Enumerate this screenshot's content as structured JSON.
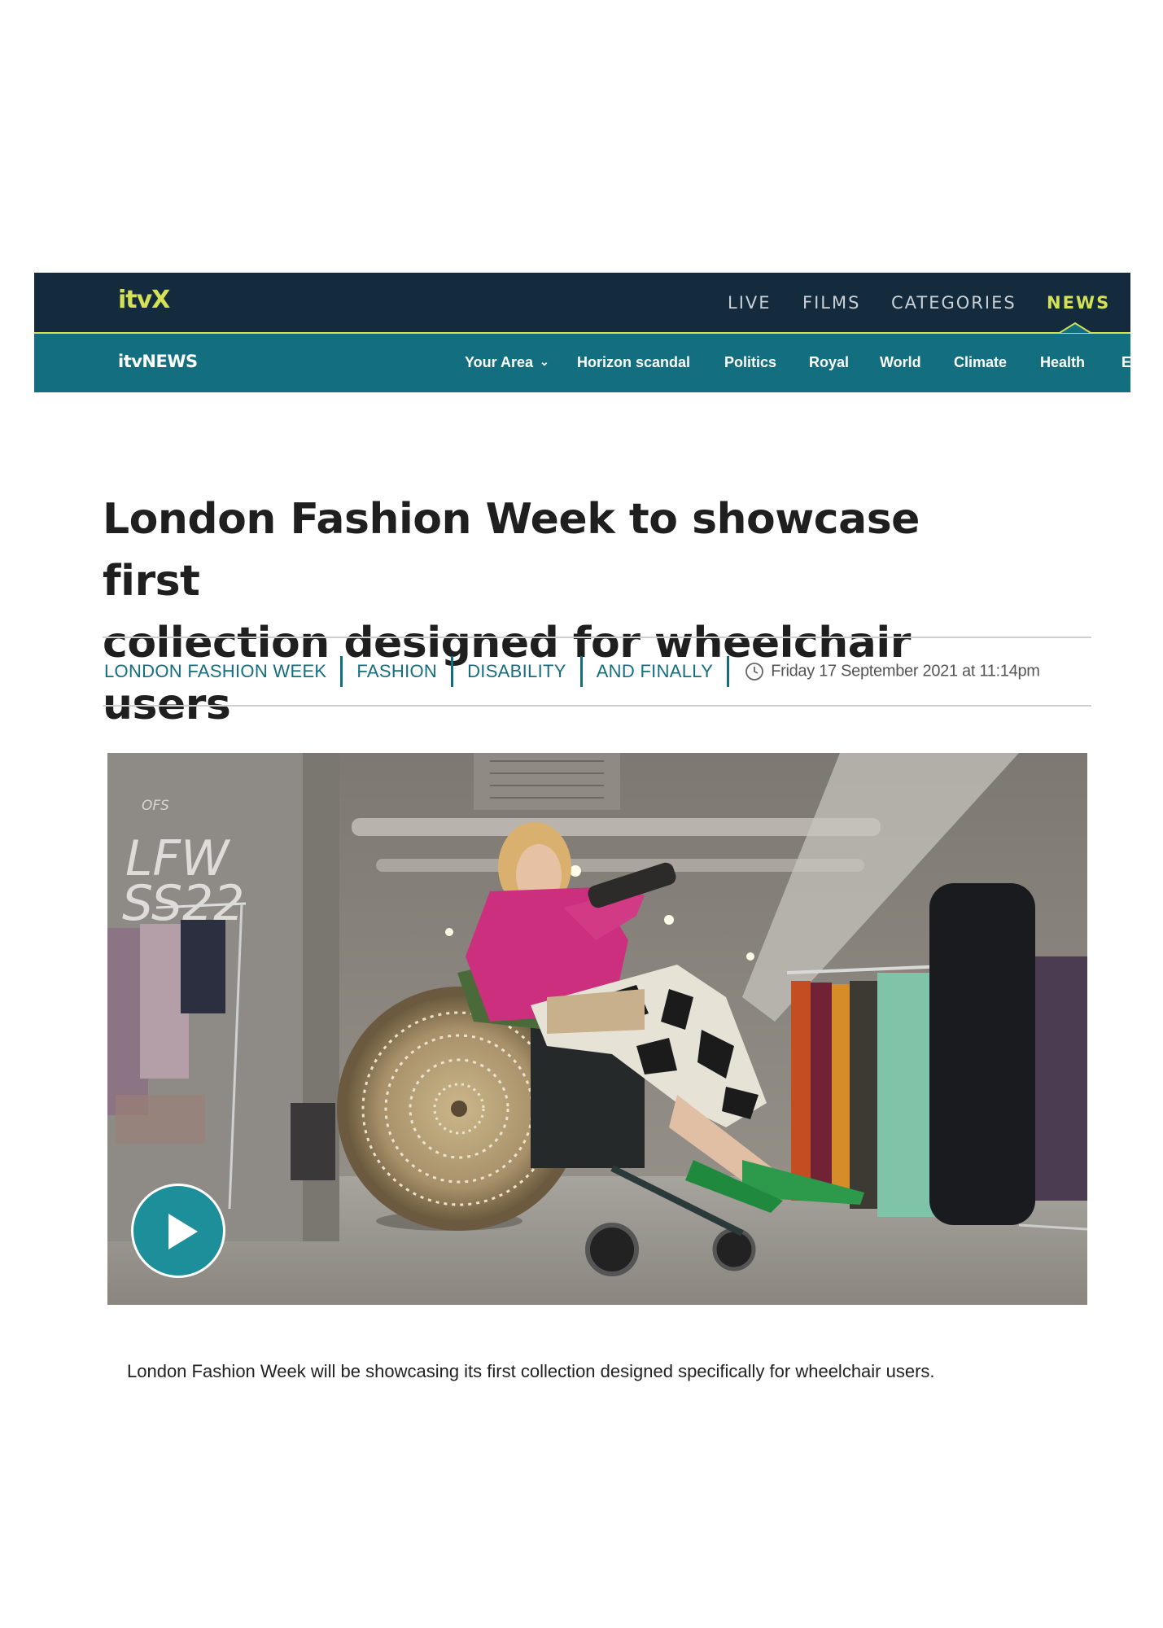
{
  "top_nav": {
    "logo": "itvX",
    "links": [
      "LIVE",
      "FILMS",
      "CATEGORIES",
      "NEWS"
    ],
    "active": "NEWS"
  },
  "sub_nav": {
    "brand": "itvNEWS",
    "items": [
      "Your Area",
      "Horizon scandal",
      "Politics",
      "Royal",
      "World",
      "Climate",
      "Health",
      "E"
    ]
  },
  "article": {
    "headline_line1": "London Fashion Week to showcase first",
    "headline_line2": "collection designed for wheelchair users",
    "tags": [
      "LONDON FASHION WEEK",
      "FASHION",
      "DISABILITY",
      "AND FINALLY"
    ],
    "published": "Friday 17 September 2021 at 11:14pm",
    "video_sign_1": "OFS",
    "video_sign_2": "LFW",
    "video_sign_3": "SS22",
    "lede": "London Fashion Week will be showcasing its first collection designed specifically for wheelchair users."
  },
  "colors": {
    "top_bar": "#132b3c",
    "sub_bar": "#136f80",
    "accent": "#d4e157",
    "tag_text": "#136f80",
    "play_button": "#1d8f9a"
  }
}
